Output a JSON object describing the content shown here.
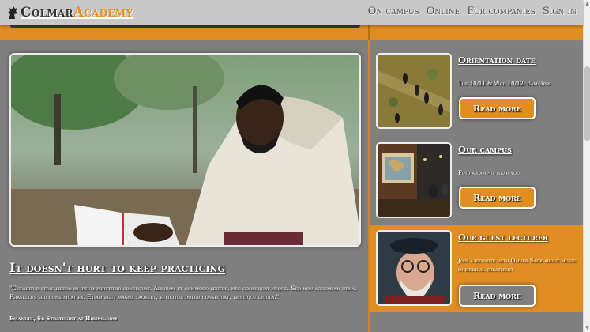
{
  "header": {
    "logo": {
      "part1": "Colmar",
      "part2": "Academy",
      "icon": "bird-icon"
    },
    "nav": [
      "On campus",
      "Online",
      "For companies",
      "Sign in"
    ]
  },
  "hero": {
    "image": "student-reading-book",
    "title": "It doesn't hurt to keep practicing",
    "quote": "\"Curabitur vitae libero in ipsum porttitor consequat. Aliquam et commodo lectus, nec consequat neque. Sed non accumsan urna. Phasellus sed consequat ex. Etiam eget magna laoreet, efficitur dolor consequat, tristique ligula.\"",
    "author": "Emanuel, Sr Strategist at Hiring.com"
  },
  "cards": [
    {
      "image": "aerial-people-walking",
      "title": "Orientation date",
      "text": "Tue 10/11 & Wed 10/12: 8am-3pm",
      "button": "Read more"
    },
    {
      "image": "campus-cafe-interior",
      "title": "Our campus",
      "text": "Find a campus near you",
      "button": "Read more"
    },
    {
      "image": "elderly-man-portrait",
      "title": "Our guest lecturer",
      "text": "Join a keynote with Oliver Sack about music in medical treatment",
      "button": "Read more"
    }
  ],
  "colors": {
    "accent": "#e08d24",
    "gray": "#7f7f7f",
    "header": "#c8c8c8"
  }
}
